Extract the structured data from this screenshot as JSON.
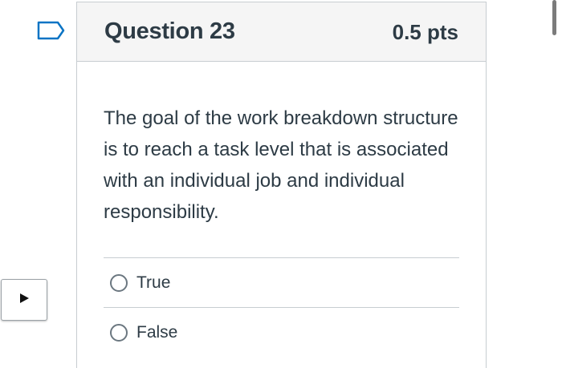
{
  "question": {
    "title": "Question 23",
    "points": "0.5 pts",
    "text": "The goal of the work breakdown structure is to reach a task level that is associated with an individual job and individual responsibility.",
    "answers": [
      {
        "label": "True",
        "selected": false
      },
      {
        "label": "False",
        "selected": false
      }
    ]
  },
  "icons": {
    "flag": "bookmark-flag-icon",
    "toggle": "play-triangle-icon"
  },
  "colors": {
    "header_bg": "#f5f5f5",
    "border": "#c7cdd1",
    "text": "#2d3b45",
    "flag": "#0b74c4"
  }
}
